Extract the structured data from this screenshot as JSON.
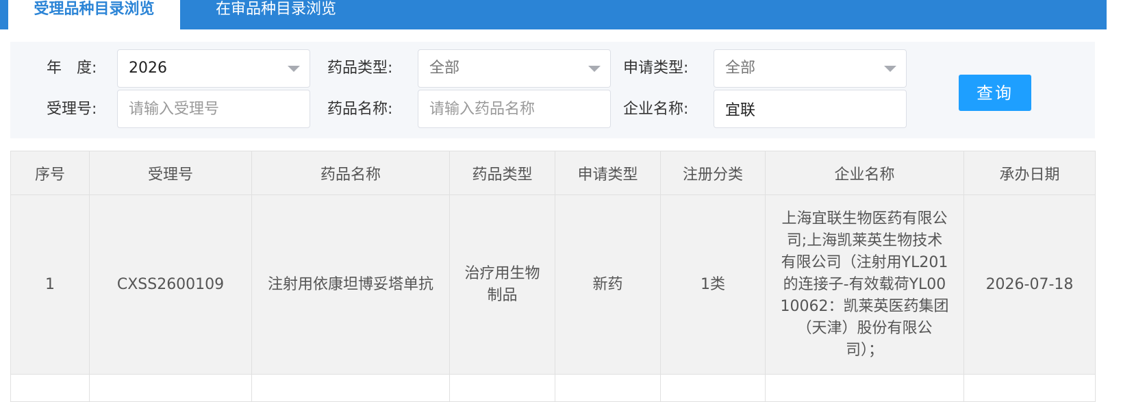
{
  "tabs": [
    {
      "label": "受理品种目录浏览",
      "active": true
    },
    {
      "label": "在审品种目录浏览",
      "active": false
    }
  ],
  "filters": {
    "year": {
      "label": "年　度:",
      "value": "2026"
    },
    "drug_type": {
      "label": "药品类型:",
      "value": "全部"
    },
    "apply_type": {
      "label": "申请类型:",
      "value": "全部"
    },
    "accept_no": {
      "label": "受理号:",
      "value": "",
      "placeholder": "请输入受理号"
    },
    "drug_name": {
      "label": "药品名称:",
      "value": "",
      "placeholder": "请输入药品名称"
    },
    "company": {
      "label": "企业名称:",
      "value": "宜联"
    }
  },
  "query_button": "查询",
  "table": {
    "headers": [
      "序号",
      "受理号",
      "药品名称",
      "药品类型",
      "申请类型",
      "注册分类",
      "企业名称",
      "承办日期"
    ],
    "rows": [
      {
        "index": "1",
        "accept_no": "CXSS2600109",
        "drug_name": "注射用依康坦博妥塔单抗",
        "drug_type": "治疗用生物制品",
        "apply_type": "新药",
        "reg_class": "1类",
        "company": "上海宜联生物医药有限公司;上海凯莱英生物技术有限公司（注射用YL201的连接子-有效载荷YL0010062：凯莱英医药集团（天津）股份有限公司）；",
        "date": "2026-07-18"
      }
    ]
  },
  "colors": {
    "tab_bar": "#2b84d6",
    "button": "#1e9fff",
    "panel": "#f5f7fa"
  }
}
